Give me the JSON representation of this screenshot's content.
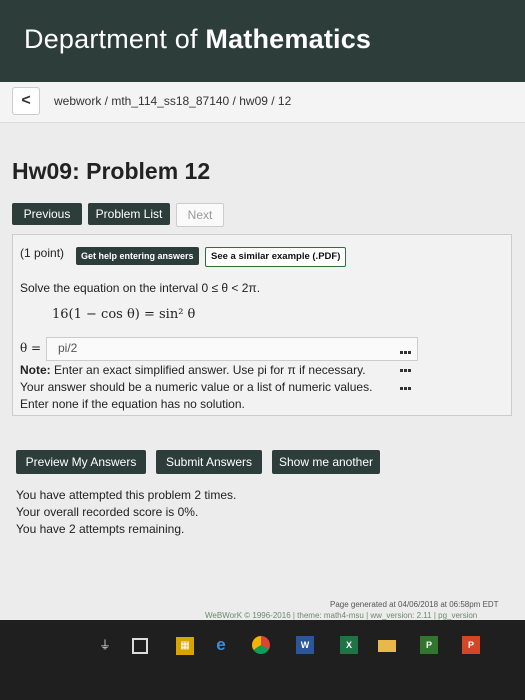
{
  "header": {
    "dept_prefix": "Department of",
    "dept_name": "Mathematics"
  },
  "breadcrumb": {
    "back_label": "<",
    "path": "webwork / mth_114_ss18_87140 / hw09 / 12"
  },
  "page_title": "Hw09: Problem 12",
  "nav": {
    "previous": "Previous",
    "problem_list": "Problem List",
    "next": "Next"
  },
  "problem": {
    "points": "(1 point)",
    "help_button": "Get help entering answers",
    "example_button": "See a similar example (.PDF)",
    "instruction": "Solve the equation on the interval 0 ≤ θ < 2π.",
    "equation": "16(1 − cos θ) = sin² θ",
    "answer_label": "θ =",
    "answer_value": "pi/2",
    "note_bold": "Note:",
    "note_line1": "Enter an exact simplified answer. Use pi for π if necessary.",
    "note_line2": "Your answer should be a numeric value or a list of numeric values.",
    "note_line3": "Enter none if the equation has no solution."
  },
  "actions": {
    "preview": "Preview My Answers",
    "submit": "Submit Answers",
    "show_another": "Show me another"
  },
  "status": {
    "line1": "You have attempted this problem 2 times.",
    "line2": "Your overall recorded score is 0%.",
    "line3": "You have 2 attempts remaining."
  },
  "footer": {
    "generated": "Page generated at 04/06/2018 at 06:58pm EDT",
    "credits": "WeBWorK © 1996-2016 | theme: math4-msu | ww_version: 2.11 | pg_version"
  },
  "colors": {
    "header_bg": "#2d3e3a",
    "button_bg": "#2d3e3a"
  },
  "taskbar_icons": [
    "usb-icon",
    "tablet-icon",
    "store-icon",
    "edge-icon",
    "chrome-icon",
    "word-icon",
    "excel-icon",
    "file-explorer-icon",
    "project-icon",
    "powerpoint-icon"
  ]
}
